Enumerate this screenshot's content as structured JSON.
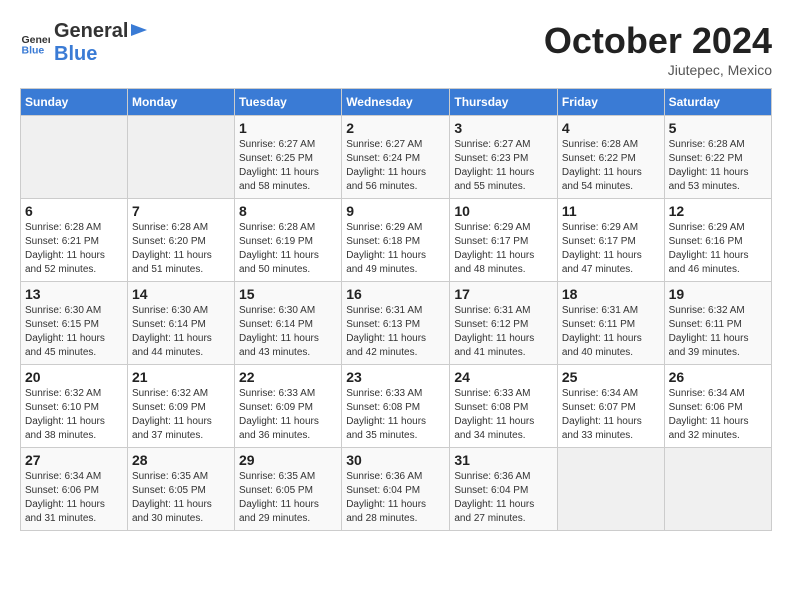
{
  "header": {
    "logo_general": "General",
    "logo_blue": "Blue",
    "month": "October 2024",
    "location": "Jiutepec, Mexico"
  },
  "columns": [
    "Sunday",
    "Monday",
    "Tuesday",
    "Wednesday",
    "Thursday",
    "Friday",
    "Saturday"
  ],
  "weeks": [
    [
      {
        "day": "",
        "info": ""
      },
      {
        "day": "",
        "info": ""
      },
      {
        "day": "1",
        "info": "Sunrise: 6:27 AM\nSunset: 6:25 PM\nDaylight: 11 hours and 58 minutes."
      },
      {
        "day": "2",
        "info": "Sunrise: 6:27 AM\nSunset: 6:24 PM\nDaylight: 11 hours and 56 minutes."
      },
      {
        "day": "3",
        "info": "Sunrise: 6:27 AM\nSunset: 6:23 PM\nDaylight: 11 hours and 55 minutes."
      },
      {
        "day": "4",
        "info": "Sunrise: 6:28 AM\nSunset: 6:22 PM\nDaylight: 11 hours and 54 minutes."
      },
      {
        "day": "5",
        "info": "Sunrise: 6:28 AM\nSunset: 6:22 PM\nDaylight: 11 hours and 53 minutes."
      }
    ],
    [
      {
        "day": "6",
        "info": "Sunrise: 6:28 AM\nSunset: 6:21 PM\nDaylight: 11 hours and 52 minutes."
      },
      {
        "day": "7",
        "info": "Sunrise: 6:28 AM\nSunset: 6:20 PM\nDaylight: 11 hours and 51 minutes."
      },
      {
        "day": "8",
        "info": "Sunrise: 6:28 AM\nSunset: 6:19 PM\nDaylight: 11 hours and 50 minutes."
      },
      {
        "day": "9",
        "info": "Sunrise: 6:29 AM\nSunset: 6:18 PM\nDaylight: 11 hours and 49 minutes."
      },
      {
        "day": "10",
        "info": "Sunrise: 6:29 AM\nSunset: 6:17 PM\nDaylight: 11 hours and 48 minutes."
      },
      {
        "day": "11",
        "info": "Sunrise: 6:29 AM\nSunset: 6:17 PM\nDaylight: 11 hours and 47 minutes."
      },
      {
        "day": "12",
        "info": "Sunrise: 6:29 AM\nSunset: 6:16 PM\nDaylight: 11 hours and 46 minutes."
      }
    ],
    [
      {
        "day": "13",
        "info": "Sunrise: 6:30 AM\nSunset: 6:15 PM\nDaylight: 11 hours and 45 minutes."
      },
      {
        "day": "14",
        "info": "Sunrise: 6:30 AM\nSunset: 6:14 PM\nDaylight: 11 hours and 44 minutes."
      },
      {
        "day": "15",
        "info": "Sunrise: 6:30 AM\nSunset: 6:14 PM\nDaylight: 11 hours and 43 minutes."
      },
      {
        "day": "16",
        "info": "Sunrise: 6:31 AM\nSunset: 6:13 PM\nDaylight: 11 hours and 42 minutes."
      },
      {
        "day": "17",
        "info": "Sunrise: 6:31 AM\nSunset: 6:12 PM\nDaylight: 11 hours and 41 minutes."
      },
      {
        "day": "18",
        "info": "Sunrise: 6:31 AM\nSunset: 6:11 PM\nDaylight: 11 hours and 40 minutes."
      },
      {
        "day": "19",
        "info": "Sunrise: 6:32 AM\nSunset: 6:11 PM\nDaylight: 11 hours and 39 minutes."
      }
    ],
    [
      {
        "day": "20",
        "info": "Sunrise: 6:32 AM\nSunset: 6:10 PM\nDaylight: 11 hours and 38 minutes."
      },
      {
        "day": "21",
        "info": "Sunrise: 6:32 AM\nSunset: 6:09 PM\nDaylight: 11 hours and 37 minutes."
      },
      {
        "day": "22",
        "info": "Sunrise: 6:33 AM\nSunset: 6:09 PM\nDaylight: 11 hours and 36 minutes."
      },
      {
        "day": "23",
        "info": "Sunrise: 6:33 AM\nSunset: 6:08 PM\nDaylight: 11 hours and 35 minutes."
      },
      {
        "day": "24",
        "info": "Sunrise: 6:33 AM\nSunset: 6:08 PM\nDaylight: 11 hours and 34 minutes."
      },
      {
        "day": "25",
        "info": "Sunrise: 6:34 AM\nSunset: 6:07 PM\nDaylight: 11 hours and 33 minutes."
      },
      {
        "day": "26",
        "info": "Sunrise: 6:34 AM\nSunset: 6:06 PM\nDaylight: 11 hours and 32 minutes."
      }
    ],
    [
      {
        "day": "27",
        "info": "Sunrise: 6:34 AM\nSunset: 6:06 PM\nDaylight: 11 hours and 31 minutes."
      },
      {
        "day": "28",
        "info": "Sunrise: 6:35 AM\nSunset: 6:05 PM\nDaylight: 11 hours and 30 minutes."
      },
      {
        "day": "29",
        "info": "Sunrise: 6:35 AM\nSunset: 6:05 PM\nDaylight: 11 hours and 29 minutes."
      },
      {
        "day": "30",
        "info": "Sunrise: 6:36 AM\nSunset: 6:04 PM\nDaylight: 11 hours and 28 minutes."
      },
      {
        "day": "31",
        "info": "Sunrise: 6:36 AM\nSunset: 6:04 PM\nDaylight: 11 hours and 27 minutes."
      },
      {
        "day": "",
        "info": ""
      },
      {
        "day": "",
        "info": ""
      }
    ]
  ]
}
